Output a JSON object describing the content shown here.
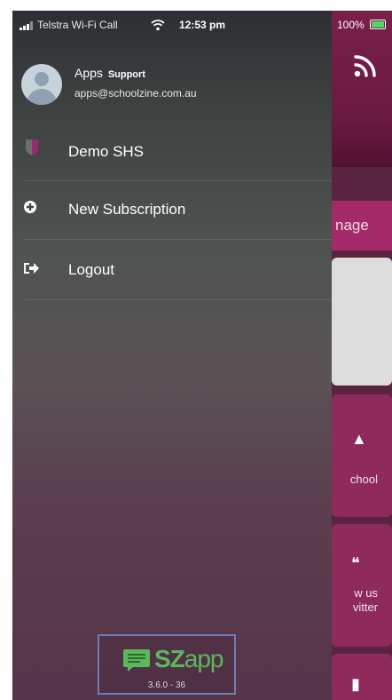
{
  "status_bar": {
    "carrier": "Telstra Wi-Fi Call",
    "time": "12:53 pm",
    "battery": "100%"
  },
  "drawer": {
    "profile": {
      "name": "Apps",
      "name_suffix": "Support",
      "email": "apps@schoolzine.com.au"
    },
    "items": [
      {
        "label": "Demo SHS",
        "icon": "school-shield-icon"
      },
      {
        "label": "New Subscription",
        "icon": "plus-circle-icon"
      },
      {
        "label": "Logout",
        "icon": "sign-out-icon"
      }
    ],
    "logo": {
      "brand_bold": "SZ",
      "brand_light": "app",
      "version": "3.6.0 - 36"
    }
  },
  "background_app": {
    "manage_partial": "nage",
    "tile_school_partial": "chool",
    "tile_follow_line1": "w us",
    "tile_follow_line2": "vitter"
  },
  "colors": {
    "brand_maroon": "#7a1f4a",
    "tile": "#8f2a5c",
    "logo_green": "#5cb85c"
  }
}
